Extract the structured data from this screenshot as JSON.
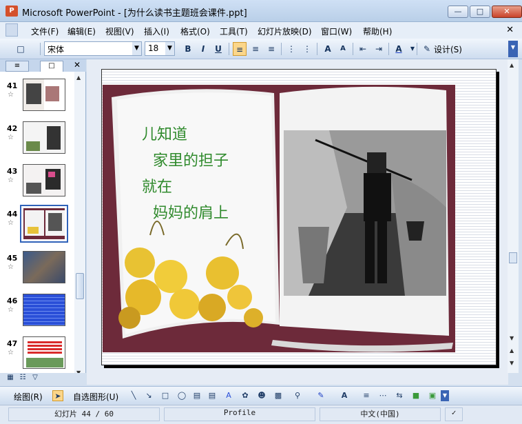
{
  "window": {
    "app_icon_text": "P",
    "title": "Microsoft PowerPoint - [为什么读书主题班会课件.ppt]"
  },
  "menu": [
    "文件(F)",
    "编辑(E)",
    "视图(V)",
    "插入(I)",
    "格式(O)",
    "工具(T)",
    "幻灯片放映(D)",
    "窗口(W)",
    "帮助(H)"
  ],
  "toolbar": {
    "font_name": "宋体",
    "font_size": "18",
    "design_label": "设计(S)"
  },
  "thumbnails": [
    {
      "num": "41",
      "star": "☆"
    },
    {
      "num": "42",
      "star": "☆"
    },
    {
      "num": "43",
      "star": "☆"
    },
    {
      "num": "44",
      "star": "☆"
    },
    {
      "num": "45",
      "star": "☆"
    },
    {
      "num": "46",
      "star": "☆"
    },
    {
      "num": "47",
      "star": "☆"
    }
  ],
  "slide": {
    "poem": [
      "儿知道",
      "家里的担子",
      "就在",
      "妈妈的肩上"
    ]
  },
  "drawbar": {
    "draw_label": "绘图(R)",
    "autoshapes_label": "自选图形(U)"
  },
  "status": {
    "slide_pos": "幻灯片 44 / 60",
    "design": "Profile",
    "language": "中文(中国)"
  },
  "colors": {
    "poem_text": "#2f8a2c",
    "book_frame": "#6d2a3a",
    "selection": "#2f62b9"
  }
}
